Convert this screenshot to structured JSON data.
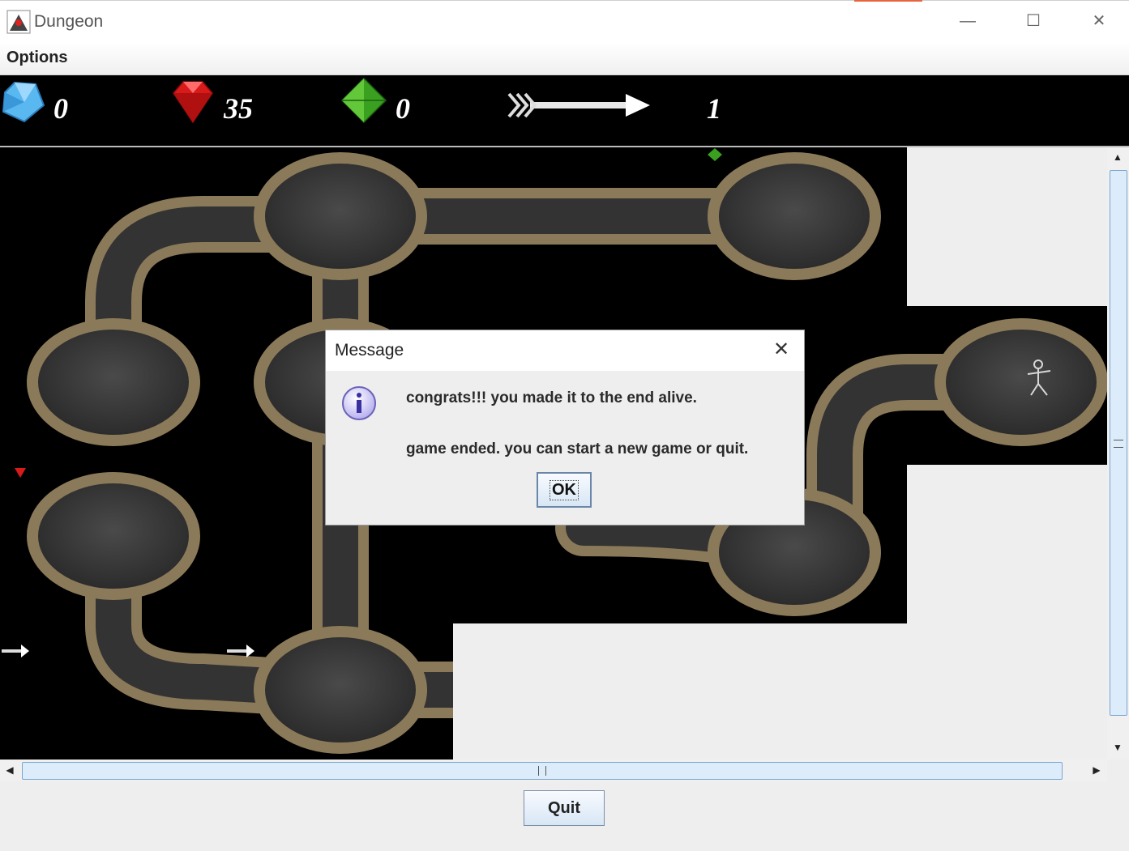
{
  "window": {
    "title": "Dungeon",
    "minimize_glyph": "—",
    "maximize_glyph": "☐",
    "close_glyph": "✕"
  },
  "menu": {
    "options_label": "Options"
  },
  "hud": {
    "blue_gem": {
      "icon": "blue-diamond-icon",
      "count": "0",
      "color": "#5ab8f0"
    },
    "red_gem": {
      "icon": "red-ruby-icon",
      "count": "35",
      "color": "#d81a1a"
    },
    "green_gem": {
      "icon": "green-emerald-icon",
      "count": "0",
      "color": "#3aa020"
    },
    "arrows": {
      "icon": "arrow-icon",
      "count": "1"
    }
  },
  "map": {
    "tile_colors": {
      "floor": "#3a3a3a",
      "wall": "#8b7a5a",
      "void": "#000000",
      "unexplored": "#eeeeee"
    },
    "items": [
      "red-gem",
      "green-gem",
      "arrow",
      "arrow"
    ],
    "player": "adventurer-sprite"
  },
  "dialog": {
    "title": "Message",
    "line1": "congrats!!! you made it to the end alive.",
    "line2": "game ended. you can start a new game or quit.",
    "ok_label": "OK",
    "icon": "info-icon"
  },
  "footer": {
    "quit_label": "Quit"
  }
}
